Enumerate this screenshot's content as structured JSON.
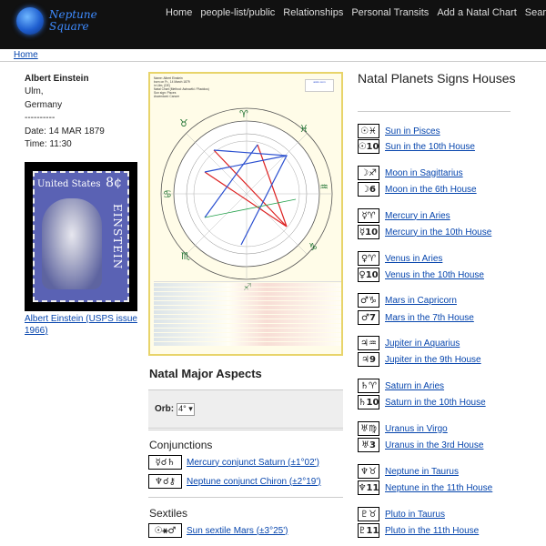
{
  "nav": {
    "logo_line1": "Neptune",
    "logo_line2": "Square",
    "links": [
      "Home",
      "people-list/public",
      "Relationships",
      "Personal Transits",
      "Add a Natal Chart",
      "Search"
    ]
  },
  "breadcrumb": {
    "home": "Home"
  },
  "person": {
    "name": "Albert Einstein",
    "city": "Ulm,",
    "country": "Germany",
    "divider": "----------",
    "date": "Date: 14 MAR 1879",
    "time": "Time: 11:30"
  },
  "stamp": {
    "title": "United States",
    "price": "8¢",
    "vertical": "EINSTEIN",
    "caption": "Albert Einstein (USPS issue 1966)"
  },
  "chart": {
    "header_lines": [
      "Name: Albert Einstein",
      "born on Fr., 14 March 1879",
      "in Ulm, (DE)",
      "Natal Chart (Method: Astrowiki / Placidus)",
      "Sun sign: Pisces",
      "Ascendant: Cancer"
    ],
    "logo_text": "astro.com"
  },
  "aspects": {
    "title": "Natal Major Aspects",
    "orb_label": "Orb:",
    "orb_value": "4°",
    "conjunctions_title": "Conjunctions",
    "conjunctions": [
      {
        "glyph": "☿☌♄",
        "label": "Mercury conjunct Saturn (±1°02')"
      },
      {
        "glyph": "♆☌⚷",
        "label": "Neptune conjunct Chiron (±2°19')"
      }
    ],
    "sextiles_title": "Sextiles",
    "sextiles": [
      {
        "glyph": "☉⚹♂",
        "label": "Sun sextile Mars (±3°25')"
      }
    ]
  },
  "planets": {
    "title": "Natal Planets Signs Houses",
    "items": [
      {
        "sign_glyph": "☉♓",
        "sign_label": "Sun in Pisces",
        "house_glyph": "☉10",
        "house_label": "Sun in the 10th House"
      },
      {
        "sign_glyph": "☽♐",
        "sign_label": "Moon in Sagittarius",
        "house_glyph": "☽6",
        "house_label": "Moon in the 6th House"
      },
      {
        "sign_glyph": "☿♈",
        "sign_label": "Mercury in Aries",
        "house_glyph": "☿10",
        "house_label": "Mercury in the 10th House"
      },
      {
        "sign_glyph": "♀♈",
        "sign_label": "Venus in Aries",
        "house_glyph": "♀10",
        "house_label": "Venus in the 10th House"
      },
      {
        "sign_glyph": "♂♑",
        "sign_label": "Mars in Capricorn",
        "house_glyph": "♂7",
        "house_label": "Mars in the 7th House"
      },
      {
        "sign_glyph": "♃♒",
        "sign_label": "Jupiter in Aquarius",
        "house_glyph": "♃9",
        "house_label": "Jupiter in the 9th House"
      },
      {
        "sign_glyph": "♄♈",
        "sign_label": "Saturn in Aries",
        "house_glyph": "♄10",
        "house_label": "Saturn in the 10th House"
      },
      {
        "sign_glyph": "♅♍",
        "sign_label": "Uranus in Virgo",
        "house_glyph": "♅3",
        "house_label": "Uranus in the 3rd House"
      },
      {
        "sign_glyph": "♆♉",
        "sign_label": "Neptune in Taurus",
        "house_glyph": "♆11",
        "house_label": "Neptune in the 11th House"
      },
      {
        "sign_glyph": "♇♉",
        "sign_label": "Pluto in Taurus",
        "house_glyph": "♇11",
        "house_label": "Pluto in the 11th House"
      }
    ]
  },
  "colors": {
    "link": "#0645ad",
    "navbar": "#111111",
    "chart_border": "#e8d46a"
  }
}
